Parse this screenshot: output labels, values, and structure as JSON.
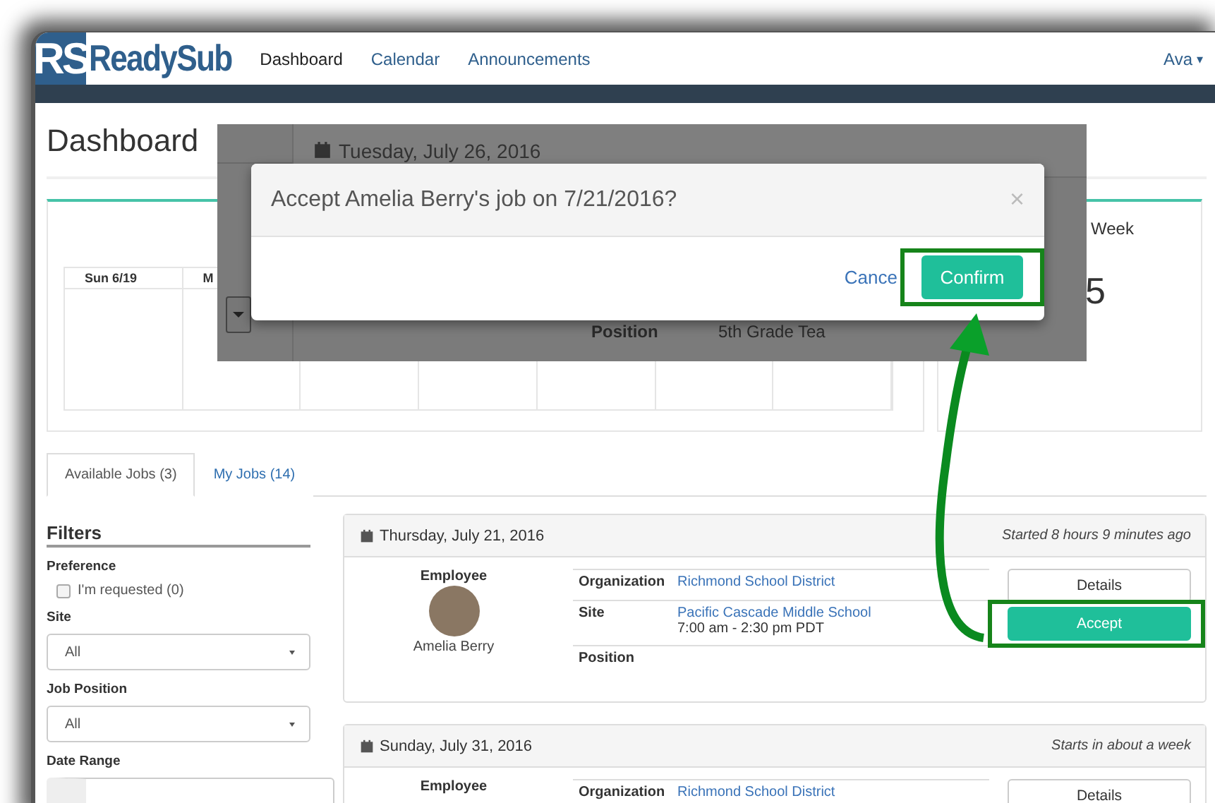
{
  "nav": {
    "logo_mark": "RS",
    "logo_text": "ReadySub",
    "links": [
      {
        "label": "Dashboard",
        "selected": true
      },
      {
        "label": "Calendar",
        "selected": false
      },
      {
        "label": "Announcements",
        "selected": false
      }
    ],
    "user": "Ava",
    "user_caret": "▾"
  },
  "page_title": "Dashboard",
  "calendar": {
    "columns": [
      "Sun 6/19",
      "M",
      "",
      "",
      "",
      "",
      ""
    ]
  },
  "week_panel": {
    "label": "Week",
    "value": "5"
  },
  "backdrop": {
    "date": "Tuesday, July 26, 2016",
    "rows": [
      {
        "label": "Position",
        "value": "5th Grade Tea"
      }
    ]
  },
  "modal": {
    "title": "Accept Amelia Berry's job on 7/21/2016?",
    "close": "×",
    "buttons": [
      {
        "label": "Cance",
        "kind": "link",
        "highlighted": false
      },
      {
        "label": "Confirm",
        "kind": "primary",
        "highlighted": true
      }
    ]
  },
  "tabs": [
    {
      "label": "Available Jobs (3)",
      "selected": true
    },
    {
      "label": "My Jobs (14)",
      "selected": false
    }
  ],
  "filters": {
    "title": "Filters",
    "groups": [
      {
        "kind": "checkbox",
        "label": "Preference",
        "option": "I'm requested (0)",
        "checked": false
      },
      {
        "kind": "select",
        "label": "Site",
        "value": "All"
      },
      {
        "kind": "select",
        "label": "Job Position",
        "value": "All"
      },
      {
        "kind": "date",
        "label": "Date Range"
      }
    ]
  },
  "jobs": [
    {
      "date": "Thursday, July 21, 2016",
      "timing": "Started 8 hours 9 minutes ago",
      "employee_label": "Employee",
      "employee": "Amelia Berry",
      "details": [
        {
          "label": "Organization",
          "value": "Richmond School District"
        },
        {
          "label": "Site",
          "value": "Pacific Cascade Middle School",
          "extra": "7:00 am - 2:30 pm PDT"
        },
        {
          "label": "Position"
        }
      ],
      "buttons": [
        {
          "label": "Details",
          "kind": "default",
          "highlighted": false
        },
        {
          "label": "Accept",
          "kind": "primary",
          "highlighted": true
        }
      ]
    },
    {
      "date": "Sunday, July 31, 2016",
      "timing": "Starts in about a week",
      "employee_label": "Employee",
      "details": [
        {
          "label": "Organization",
          "value": "Richmond School District"
        }
      ],
      "buttons": [
        {
          "label": "Details",
          "kind": "default",
          "highlighted": false
        }
      ]
    }
  ]
}
